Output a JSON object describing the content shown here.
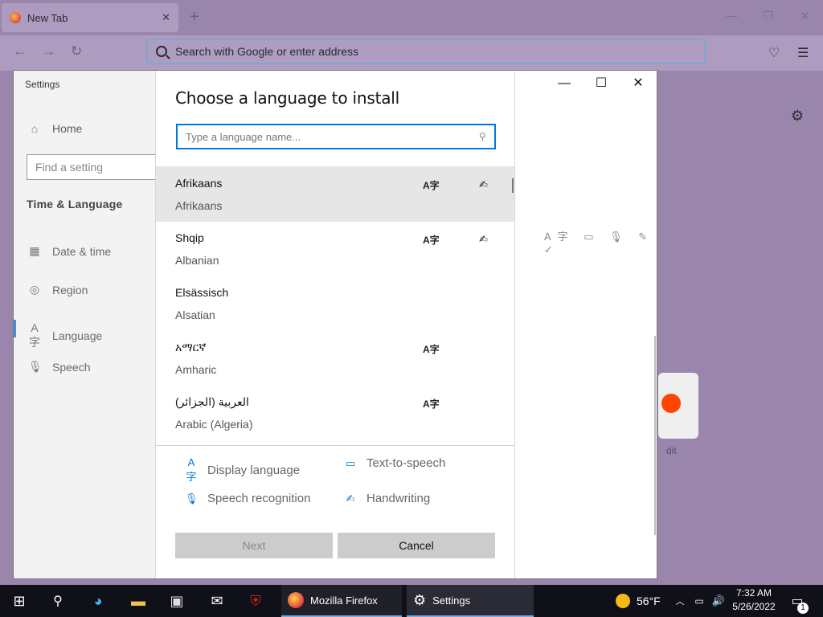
{
  "browser": {
    "tab_title": "New Tab",
    "tab_close": "✕",
    "new_tab": "+",
    "url_placeholder": "Search with Google or enter address"
  },
  "settings": {
    "title": "Settings",
    "home": "Home",
    "find_placeholder": "Find a setting",
    "section": "Time & Language",
    "nav": [
      {
        "label": "Date & time",
        "icon": "calendar-clock-icon"
      },
      {
        "label": "Region",
        "icon": "globe-icon"
      },
      {
        "label": "Language",
        "icon": "language-icon"
      },
      {
        "label": "Speech",
        "icon": "microphone-icon"
      }
    ],
    "reddit_label": "dit"
  },
  "dialog": {
    "title": "Choose a language to install",
    "search_placeholder": "Type a language name...",
    "languages": [
      {
        "native": "Afrikaans",
        "english": "Afrikaans",
        "display_language": true,
        "handwriting": true,
        "selected": true
      },
      {
        "native": "Shqip",
        "english": "Albanian",
        "display_language": true,
        "handwriting": true,
        "selected": false
      },
      {
        "native": "Elsässisch",
        "english": "Alsatian",
        "display_language": false,
        "handwriting": false,
        "selected": false
      },
      {
        "native": "አማርኛ",
        "english": "Amharic",
        "display_language": true,
        "handwriting": false,
        "selected": false
      },
      {
        "native": "العربية (الجزائر)",
        "english": "Arabic (Algeria)",
        "display_language": true,
        "handwriting": false,
        "selected": false
      }
    ],
    "legend": {
      "display_language": "Display language",
      "text_to_speech": "Text-to-speech",
      "speech_recognition": "Speech recognition",
      "handwriting": "Handwriting"
    },
    "next_label": "Next",
    "cancel_label": "Cancel"
  },
  "taskbar": {
    "firefox_label": "Mozilla Firefox",
    "settings_label": "Settings",
    "temperature": "56°F",
    "time": "7:32 AM",
    "date": "5/26/2022",
    "notification_count": "1"
  },
  "colors": {
    "accent": "#0078d7",
    "browser_bg": "#9a86ad",
    "taskbar_bg": "#101018"
  }
}
